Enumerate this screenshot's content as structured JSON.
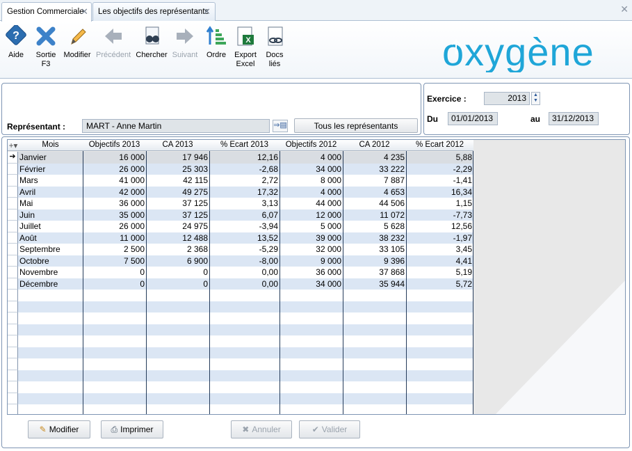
{
  "tabs": [
    {
      "label": "Gestion Commerciale"
    },
    {
      "label": "Les objectifs des représentants"
    }
  ],
  "toolbar": {
    "aide": "Aide",
    "sortie_1": "Sortie",
    "sortie_2": "F3",
    "modifier": "Modifier",
    "precedent": "Précédent",
    "chercher": "Chercher",
    "suivant": "Suivant",
    "ordre": "Ordre",
    "export_1": "Export",
    "export_2": "Excel",
    "docs_1": "Docs",
    "docs_2": "liés"
  },
  "logo": {
    "text": "oxygène"
  },
  "representant": {
    "label": "Représentant :",
    "value": "MART - Anne Martin",
    "all_button": "Tous les représentants"
  },
  "exercice": {
    "label": "Exercice :",
    "value": "2013",
    "du_label": "Du",
    "du_value": "01/01/2013",
    "au_label": "au",
    "au_value": "31/12/2013"
  },
  "grid": {
    "columns": [
      "Mois",
      "Objectifs 2013",
      "CA 2013",
      "% Ecart 2013",
      "Objectifs 2012",
      "CA 2012",
      "% Ecart 2012"
    ],
    "rows": [
      [
        "Janvier",
        "16 000",
        "17 946",
        "12,16",
        "4 000",
        "4 235",
        "5,88"
      ],
      [
        "Février",
        "26 000",
        "25 303",
        "-2,68",
        "34 000",
        "33 222",
        "-2,29"
      ],
      [
        "Mars",
        "41 000",
        "42 115",
        "2,72",
        "8 000",
        "7 887",
        "-1,41"
      ],
      [
        "Avril",
        "42 000",
        "49 275",
        "17,32",
        "4 000",
        "4 653",
        "16,34"
      ],
      [
        "Mai",
        "36 000",
        "37 125",
        "3,13",
        "44 000",
        "44 506",
        "1,15"
      ],
      [
        "Juin",
        "35 000",
        "37 125",
        "6,07",
        "12 000",
        "11 072",
        "-7,73"
      ],
      [
        "Juillet",
        "26 000",
        "24 975",
        "-3,94",
        "5 000",
        "5 628",
        "12,56"
      ],
      [
        "Août",
        "11 000",
        "12 488",
        "13,52",
        "39 000",
        "38 232",
        "-1,97"
      ],
      [
        "Septembre",
        "2 500",
        "2 368",
        "-5,29",
        "32 000",
        "33 105",
        "3,45"
      ],
      [
        "Octobre",
        "7 500",
        "6 900",
        "-8,00",
        "9 000",
        "9 396",
        "4,41"
      ],
      [
        "Novembre",
        "0",
        "0",
        "0,00",
        "36 000",
        "37 868",
        "5,19"
      ],
      [
        "Décembre",
        "0",
        "0",
        "0,00",
        "34 000",
        "35 944",
        "5,72"
      ]
    ]
  },
  "buttons": {
    "modifier": "Modifier",
    "imprimer": "Imprimer",
    "annuler": "Annuler",
    "valider": "Valider"
  },
  "colors": {
    "accent": "#1fa6d8",
    "row_alt": "#dbe6f4",
    "border": "#7e95b3"
  }
}
